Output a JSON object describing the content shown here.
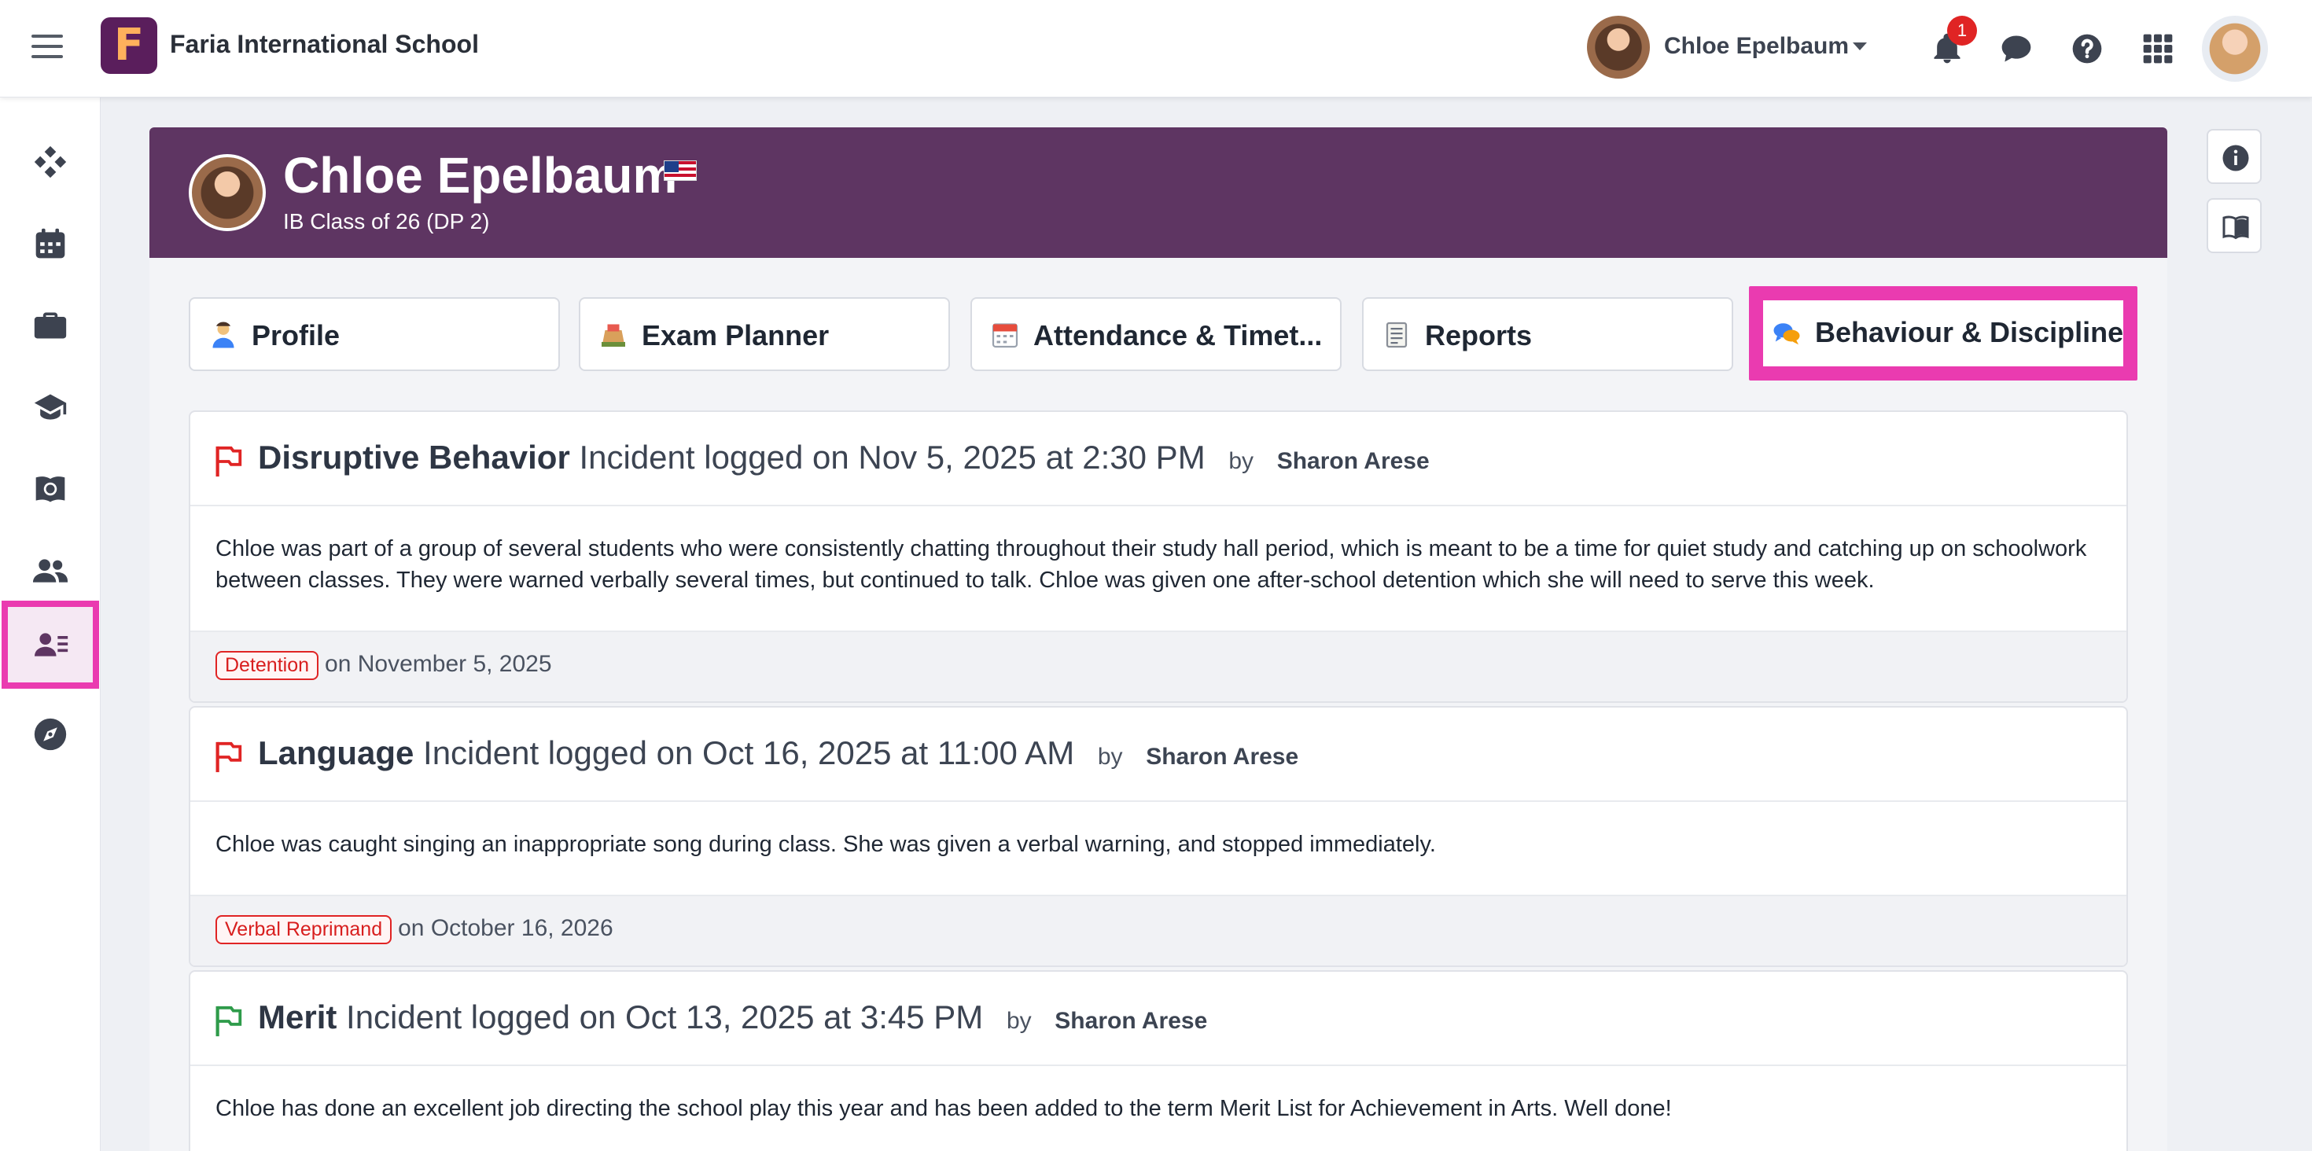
{
  "topbar": {
    "school_name": "Faria International School",
    "logo_letter": "F",
    "user_name": "Chloe Epelbaum",
    "notification_count": "1"
  },
  "student": {
    "name": "Chloe Epelbaum",
    "class": "IB Class of 26 (DP 2)"
  },
  "tabs": [
    {
      "label": "Profile",
      "icon": "student-icon"
    },
    {
      "label": "Exam Planner",
      "icon": "exam-icon"
    },
    {
      "label": "Attendance & Timet...",
      "icon": "calendar-icon"
    },
    {
      "label": "Reports",
      "icon": "report-icon"
    },
    {
      "label": "Behaviour & Discipline",
      "icon": "speech-bubbles-icon",
      "active": true
    }
  ],
  "incidents": [
    {
      "type": "Disruptive Behavior",
      "logged": "Incident logged on Nov 5, 2025 at 2:30 PM",
      "by": "by",
      "author": "Sharon Arese",
      "description": "Chloe was part of a group of several students who were consistently chatting throughout their study hall period, which is meant to be a time for quiet study and catching up on schoolwork between classes. They were warned verbally several times, but continued to talk. Chloe was given one after-school detention which she will need to serve this week.",
      "action": "Detention",
      "action_date": "on November 5, 2025",
      "flag_color": "#e02424"
    },
    {
      "type": "Language",
      "logged": "Incident logged on Oct 16, 2025 at 11:00 AM",
      "by": "by",
      "author": "Sharon Arese",
      "description": "Chloe was caught singing an inappropriate song during class. She was given a verbal warning, and stopped immediately.",
      "action": "Verbal Reprimand",
      "action_date": "on October 16, 2026",
      "flag_color": "#e02424"
    },
    {
      "type": "Merit",
      "logged": "Incident logged on Oct 13, 2025 at 3:45 PM",
      "by": "by",
      "author": "Sharon Arese",
      "description": "Chloe has done an excellent job directing the school play this year and has been added to the term Merit List for Achievement in Arts. Well done!",
      "flag_color": "#2e9b4a"
    }
  ],
  "colors": {
    "banner": "#5e3562",
    "highlight": "#ea3bb0",
    "tag_red": "#e02424"
  }
}
